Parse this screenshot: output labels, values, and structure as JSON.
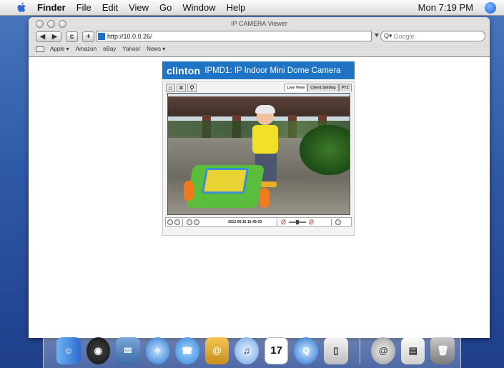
{
  "menubar": {
    "items": [
      "Finder",
      "File",
      "Edit",
      "View",
      "Go",
      "Window",
      "Help"
    ],
    "clock": "Mon 7:19 PM"
  },
  "browser": {
    "title": "IP CAMERA Viewer",
    "url": "http://10.0.0.26/",
    "search_placeholder": "Google",
    "bookmarks": [
      "Apple ▾",
      "Amazon",
      "eBay",
      "Yahoo!",
      "News ▾"
    ]
  },
  "camera": {
    "brand": "clinton",
    "model_title": "IPMD1: IP Indoor Mini Dome Camera",
    "tabs": [
      "Live View",
      "Client Setting",
      "PTZ"
    ],
    "active_tab": "Live View",
    "timestamp": "2012-05-16 15:49:33"
  },
  "dock": {
    "apps": [
      "finder-icon",
      "dashboard-icon",
      "mail-icon",
      "safari-icon",
      "ichat-icon",
      "address-book-icon",
      "itunes-icon",
      "ical-icon",
      "quicktime-icon",
      "preview-icon",
      "mail-downloads-icon",
      "documents-icon",
      "trash-icon"
    ],
    "ical_day": "17"
  },
  "colors": {
    "camera_header": "#1f73c4",
    "desktop": "#2f5aa8"
  }
}
